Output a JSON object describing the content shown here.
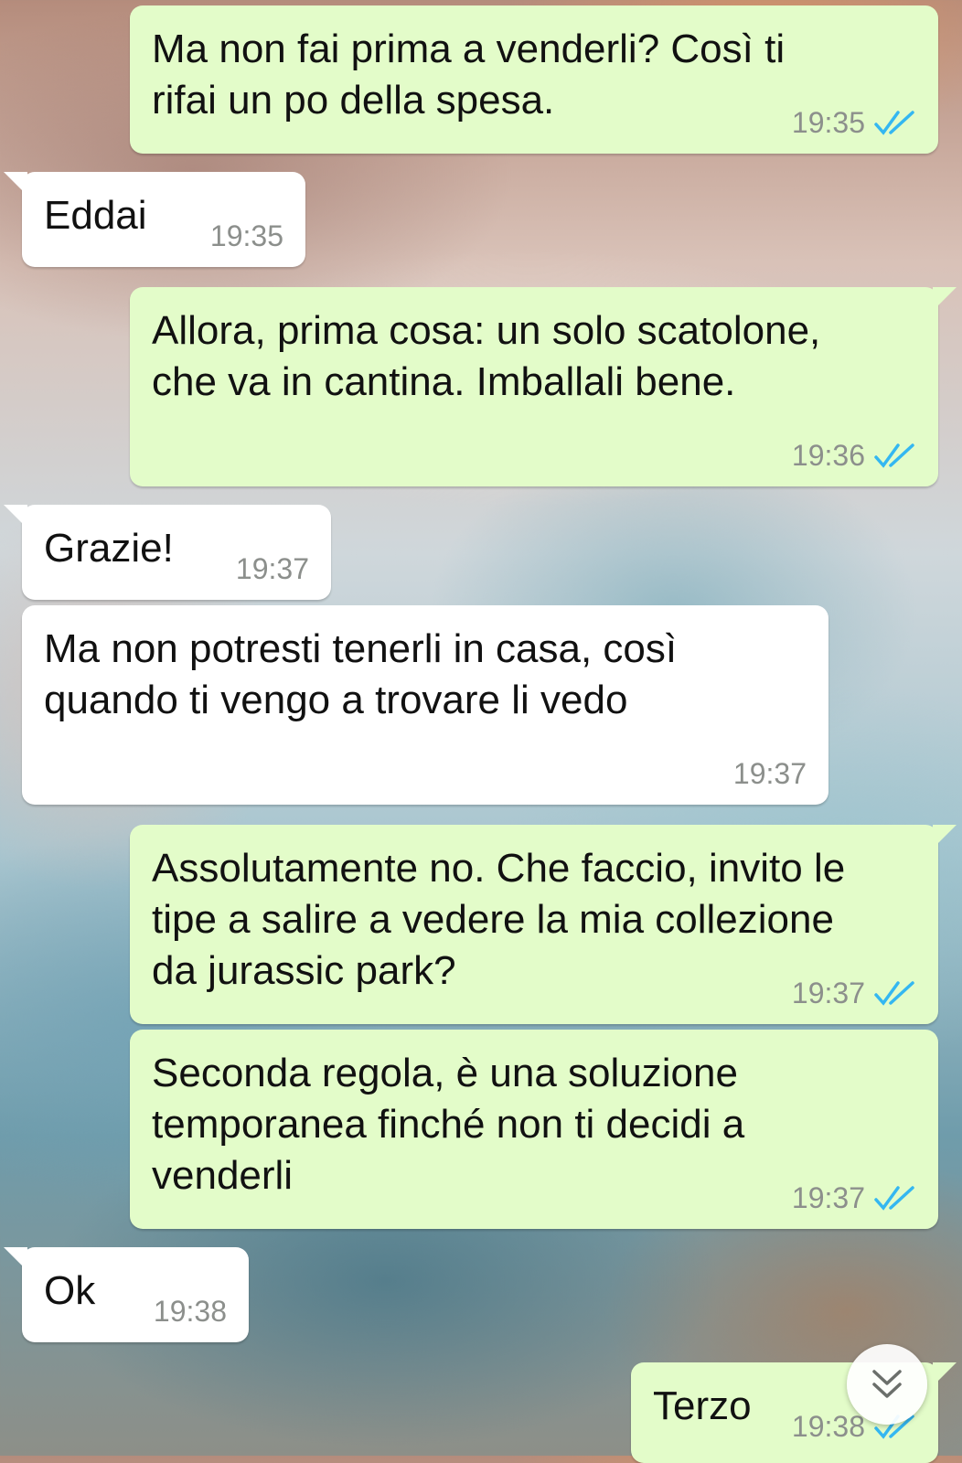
{
  "colors": {
    "outgoing_bubble": "#e3fcc9",
    "incoming_bubble": "#ffffff",
    "time_text": "#8c8f8c",
    "read_ticks": "#34b7f1"
  },
  "messages": [
    {
      "direction": "out",
      "text": "Ma non fai prima a venderli? Così ti\nrifai un po della spesa.",
      "time": "19:35",
      "status": "read"
    },
    {
      "direction": "in",
      "text": "Eddai",
      "time": "19:35"
    },
    {
      "direction": "out",
      "text": "Allora, prima cosa: un solo scatolone,\nche va in cantina. Imballali bene.",
      "time": "19:36",
      "status": "read"
    },
    {
      "direction": "in",
      "text": "Grazie!",
      "time": "19:37"
    },
    {
      "direction": "in",
      "text": "Ma non potresti tenerli in casa, così\nquando ti vengo a trovare li vedo",
      "time": "19:37"
    },
    {
      "direction": "out",
      "text": "Assolutamente no. Che faccio, invito le\ntipe a salire a vedere la mia collezione\nda jurassic park?",
      "time": "19:37",
      "status": "read"
    },
    {
      "direction": "out",
      "text": "Seconda regola, è una soluzione\ntemporanea finché non ti decidi a\nvenderli",
      "time": "19:37",
      "status": "read"
    },
    {
      "direction": "in",
      "text": "Ok",
      "time": "19:38"
    },
    {
      "direction": "out",
      "text": "Terzo",
      "time": "19:38",
      "status": "read"
    }
  ],
  "scroll_button": {
    "icon": "double-chevron-down-icon"
  }
}
